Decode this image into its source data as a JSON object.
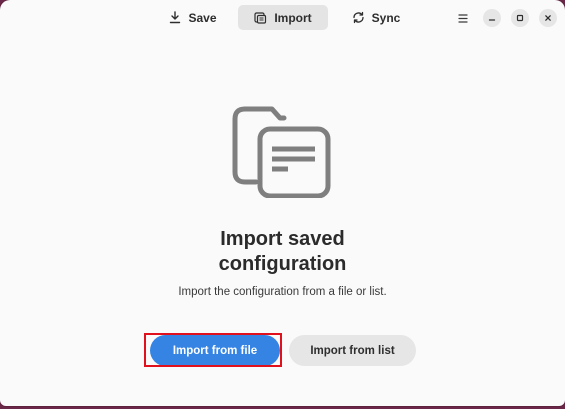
{
  "header": {
    "tabs": [
      {
        "label": "Save",
        "icon": "save-icon",
        "active": false
      },
      {
        "label": "Import",
        "icon": "import-icon",
        "active": true
      },
      {
        "label": "Sync",
        "icon": "sync-icon",
        "active": false
      }
    ],
    "window_controls": [
      "menu-icon",
      "minimize-icon",
      "maximize-icon",
      "close-icon"
    ]
  },
  "main": {
    "icon": "documents-icon",
    "title_line1": "Import saved",
    "title_line2": "configuration",
    "subtitle": "Import the configuration from a file or list.",
    "primary_button": "Import from file",
    "secondary_button": "Import from list"
  },
  "colors": {
    "accent": "#3584e4",
    "highlight_box": "#e0101d",
    "background": "#fafafa"
  }
}
